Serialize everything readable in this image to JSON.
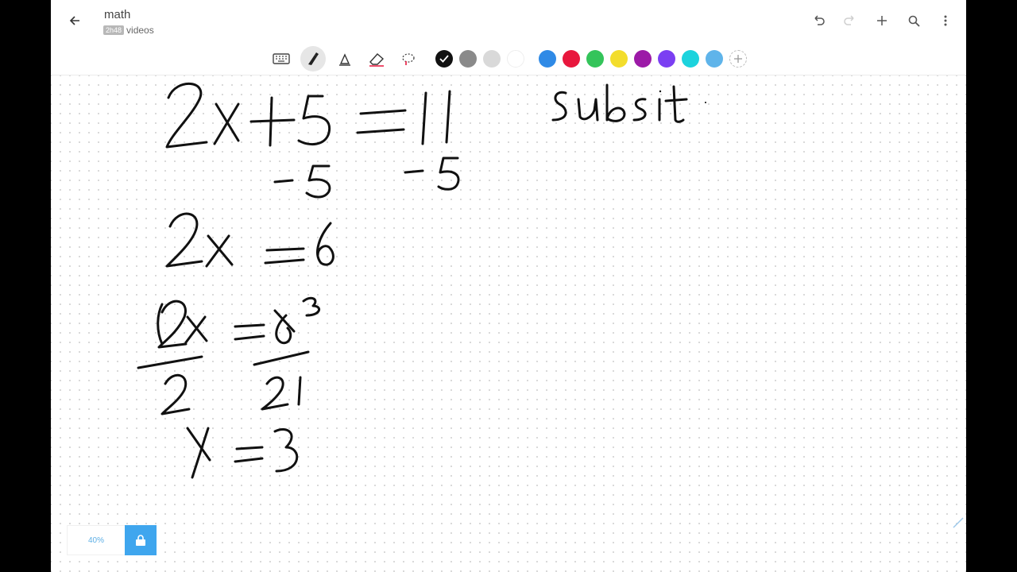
{
  "header": {
    "title": "math",
    "badge": "2h48",
    "subtitle": "videos",
    "back_icon": "arrow-left-icon",
    "actions": [
      "undo-icon",
      "redo-icon",
      "plus-icon",
      "search-icon",
      "more-vert-icon"
    ]
  },
  "toolbar": {
    "tools": [
      "keyboard-icon",
      "pen-icon",
      "highlighter-icon",
      "eraser-icon",
      "lasso-icon"
    ],
    "active_tool": "pen-icon",
    "colors": [
      "#111111",
      "#8a8a8a",
      "#d9d9d9",
      "#ffffff",
      "#2f8ae6",
      "#e8173d",
      "#34c45a",
      "#f3dd2c",
      "#9c1aa7",
      "#7b3ff2",
      "#1cd3dd",
      "#5fb4ea"
    ],
    "selected_color": "#111111"
  },
  "canvas": {
    "handwriting_lines": [
      "2x + 5 = 11",
      "-5   -5",
      "2x = 6",
      "2x/2 = 6/2  (3 over 1)",
      "X = 3"
    ],
    "handwriting_note": "Subsit"
  },
  "footer": {
    "zoom_label": "40%",
    "lock_icon": "lock-icon"
  }
}
